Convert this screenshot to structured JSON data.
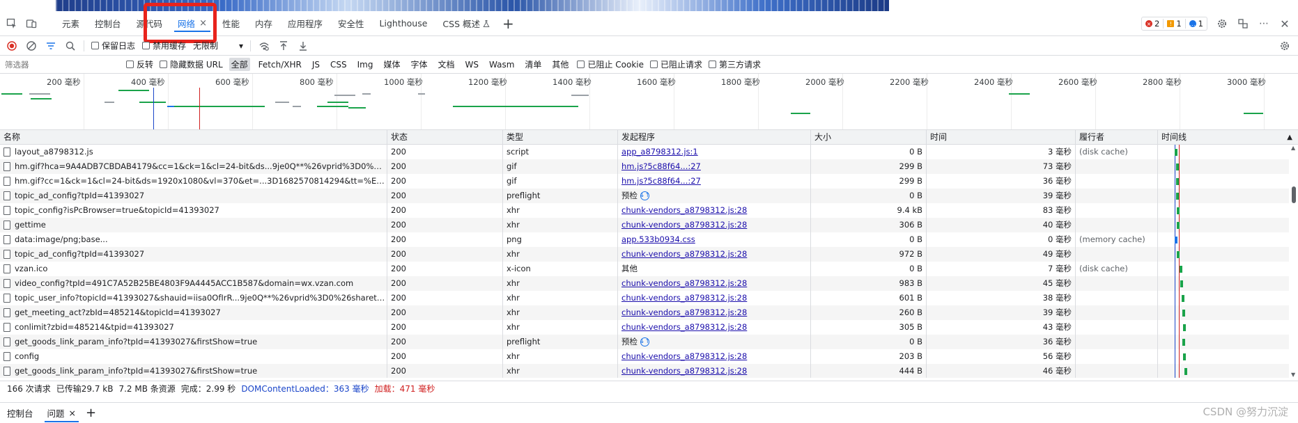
{
  "tabs": [
    {
      "label": "元素"
    },
    {
      "label": "控制台"
    },
    {
      "label": "源代码"
    },
    {
      "label": "网络",
      "active": true,
      "close": "×"
    },
    {
      "label": "性能"
    },
    {
      "label": "内存"
    },
    {
      "label": "应用程序"
    },
    {
      "label": "安全性"
    },
    {
      "label": "Lighthouse"
    },
    {
      "label": "CSS 概述"
    }
  ],
  "badges": {
    "errors": "2",
    "warnings": "1",
    "messages": "1"
  },
  "toolbar": {
    "preserve_log": "保留日志",
    "disable_cache": "禁用缓存",
    "throttle": "无限制"
  },
  "filter": {
    "placeholder": "筛选器",
    "invert": "反转",
    "hide_data_urls": "隐藏数据 URL",
    "types": [
      "全部",
      "Fetch/XHR",
      "JS",
      "CSS",
      "Img",
      "媒体",
      "字体",
      "文档",
      "WS",
      "Wasm",
      "清单",
      "其他"
    ],
    "blocked_cookies": "已阻止 Cookie",
    "blocked_requests": "已阻止请求",
    "third_party": "第三方请求"
  },
  "overview_ticks": [
    "200 毫秒",
    "400 毫秒",
    "600 毫秒",
    "800 毫秒",
    "1000 毫秒",
    "1200 毫秒",
    "1400 毫秒",
    "1600 毫秒",
    "1800 毫秒",
    "2000 毫秒",
    "2200 毫秒",
    "2400 毫秒",
    "2600 毫秒",
    "2800 毫秒",
    "3000 毫秒"
  ],
  "columns": {
    "name": "名称",
    "status": "状态",
    "type": "类型",
    "initiator": "发起程序",
    "size": "大小",
    "time": "时间",
    "fulfilled_by": "履行者",
    "waterfall": "时间线"
  },
  "rows": [
    {
      "name": "layout_a8798312.js",
      "status": "200",
      "type": "script",
      "initiator": "app_a8798312.js:1",
      "size": "0 B",
      "time": "3 毫秒",
      "fulfilled": "(disk cache)",
      "link": true
    },
    {
      "name": "hm.gif?hca=9A4ADB7CBDAB4179&cc=1&ck=1&cl=24-bit&ds...9je0Q**%26vprid%3D0%26sharet...",
      "status": "200",
      "type": "gif",
      "initiator": "hm.js?5c88f64...:27",
      "size": "299 B",
      "time": "73 毫秒",
      "fulfilled": "",
      "link": true
    },
    {
      "name": "hm.gif?cc=1&ck=1&cl=24-bit&ds=1920x1080&vl=370&et=...3D1682570814294&tt=%E5%8A%A...",
      "status": "200",
      "type": "gif",
      "initiator": "hm.js?5c88f64...:27",
      "size": "299 B",
      "time": "36 毫秒",
      "fulfilled": "",
      "link": true
    },
    {
      "name": "topic_ad_config?tpId=41393027",
      "status": "200",
      "type": "preflight",
      "initiator": "预检",
      "size": "0 B",
      "time": "39 毫秒",
      "fulfilled": "",
      "link": false,
      "preflight": true
    },
    {
      "name": "topic_config?isPcBrowser=true&topicId=41393027",
      "status": "200",
      "type": "xhr",
      "initiator": "chunk-vendors_a8798312.js:28",
      "size": "9.4 kB",
      "time": "83 毫秒",
      "fulfilled": "",
      "link": true
    },
    {
      "name": "gettime",
      "status": "200",
      "type": "xhr",
      "initiator": "chunk-vendors_a8798312.js:28",
      "size": "306 B",
      "time": "40 毫秒",
      "fulfilled": "",
      "link": true
    },
    {
      "name": "data:image/png;base...",
      "status": "200",
      "type": "png",
      "initiator": "app.533b0934.css",
      "size": "0 B",
      "time": "0 毫秒",
      "fulfilled": "(memory cache)",
      "link": true
    },
    {
      "name": "topic_ad_config?tpId=41393027",
      "status": "200",
      "type": "xhr",
      "initiator": "chunk-vendors_a8798312.js:28",
      "size": "972 B",
      "time": "49 毫秒",
      "fulfilled": "",
      "link": true
    },
    {
      "name": "vzan.ico",
      "status": "200",
      "type": "x-icon",
      "initiator": "其他",
      "size": "0 B",
      "time": "7 毫秒",
      "fulfilled": "(disk cache)",
      "link": false
    },
    {
      "name": "video_config?tpId=491C7A52B25BE4803F9A4445ACC1B587&domain=wx.vzan.com",
      "status": "200",
      "type": "xhr",
      "initiator": "chunk-vendors_a8798312.js:28",
      "size": "983 B",
      "time": "45 毫秒",
      "fulfilled": "",
      "link": true
    },
    {
      "name": "topic_user_info?topicId=41393027&shauid=iisa0OfIrR...9je0Q**%26vprid%3D0%26sharetstamp%...",
      "status": "200",
      "type": "xhr",
      "initiator": "chunk-vendors_a8798312.js:28",
      "size": "601 B",
      "time": "38 毫秒",
      "fulfilled": "",
      "link": true
    },
    {
      "name": "get_meeting_act?zbId=485214&topicId=41393027",
      "status": "200",
      "type": "xhr",
      "initiator": "chunk-vendors_a8798312.js:28",
      "size": "260 B",
      "time": "39 毫秒",
      "fulfilled": "",
      "link": true
    },
    {
      "name": "conlimit?zbid=485214&tpid=41393027",
      "status": "200",
      "type": "xhr",
      "initiator": "chunk-vendors_a8798312.js:28",
      "size": "305 B",
      "time": "43 毫秒",
      "fulfilled": "",
      "link": true
    },
    {
      "name": "get_goods_link_param_info?tpId=41393027&firstShow=true",
      "status": "200",
      "type": "preflight",
      "initiator": "预检",
      "size": "0 B",
      "time": "36 毫秒",
      "fulfilled": "",
      "link": false,
      "preflight": true
    },
    {
      "name": "config",
      "status": "200",
      "type": "xhr",
      "initiator": "chunk-vendors_a8798312.js:28",
      "size": "203 B",
      "time": "56 毫秒",
      "fulfilled": "",
      "link": true
    },
    {
      "name": "get_goods_link_param_info?tpId=41393027&firstShow=true",
      "status": "200",
      "type": "xhr",
      "initiator": "chunk-vendors_a8798312.js:28",
      "size": "444 B",
      "time": "46 毫秒",
      "fulfilled": "",
      "link": true
    }
  ],
  "status_bar": {
    "requests": "166 次请求",
    "transferred": "已传输29.7 kB",
    "resources": "7.2 MB 条资源",
    "finish": "完成：2.99 秒",
    "dcl_label": "DOMContentLoaded：",
    "dcl_value": "363 毫秒",
    "load_label": "加载：",
    "load_value": "471 毫秒"
  },
  "drawer": {
    "console": "控制台",
    "issues": "问题",
    "close": "×"
  },
  "watermark": "CSDN @努力沉淀",
  "colors": {
    "accent": "#1a73e8",
    "highlight": "#e8231c",
    "bar_green": "#1aa34a",
    "dcl_line": "#1a45c9",
    "load_line": "#d01f1f"
  }
}
